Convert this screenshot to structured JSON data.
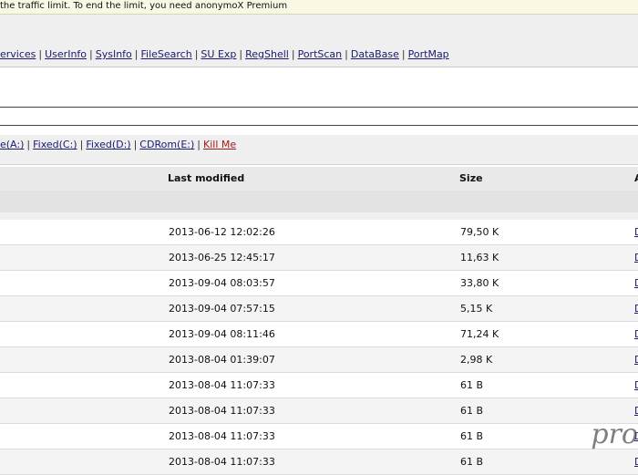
{
  "notice": {
    "text": "the traffic limit. To end the limit, you need anonymoX Premium"
  },
  "nav": {
    "items": [
      {
        "label": "ervices"
      },
      {
        "label": "UserInfo"
      },
      {
        "label": "SysInfo"
      },
      {
        "label": "FileSearch"
      },
      {
        "label": "SU Exp"
      },
      {
        "label": "RegShell"
      },
      {
        "label": "PortScan"
      },
      {
        "label": "DataBase"
      },
      {
        "label": "PortMap"
      }
    ],
    "separator": "|"
  },
  "drives": {
    "items": [
      {
        "label": "e(A:)"
      },
      {
        "label": "Fixed(C:)"
      },
      {
        "label": "Fixed(D:)"
      },
      {
        "label": "CDRom(E:)"
      }
    ],
    "kill_label": "Kill Me",
    "separator": "|"
  },
  "table": {
    "headers": {
      "last_modified": "Last modified",
      "size": "Size",
      "action": "A"
    },
    "rows": [
      {
        "modified": "2013-06-12 12:02:26",
        "size": "79,50 K",
        "action": "D"
      },
      {
        "modified": "2013-06-25 12:45:17",
        "size": "11,63 K",
        "action": "D"
      },
      {
        "modified": "2013-09-04 08:03:57",
        "size": "33,80 K",
        "action": "D"
      },
      {
        "modified": "2013-09-04 07:57:15",
        "size": "5,15 K",
        "action": "D"
      },
      {
        "modified": "2013-09-04 08:11:46",
        "size": "71,24 K",
        "action": "D"
      },
      {
        "modified": "2013-08-04 01:39:07",
        "size": "2,98 K",
        "action": "D"
      },
      {
        "modified": "2013-08-04 11:07:33",
        "size": "61 B",
        "action": "D"
      },
      {
        "modified": "2013-08-04 11:07:33",
        "size": "61 B",
        "action": "D"
      },
      {
        "modified": "2013-08-04 11:07:33",
        "size": "61 B",
        "action": "D"
      },
      {
        "modified": "2013-08-04 11:07:33",
        "size": "61 B",
        "action": "D"
      }
    ]
  },
  "watermark": {
    "text": "pro"
  }
}
